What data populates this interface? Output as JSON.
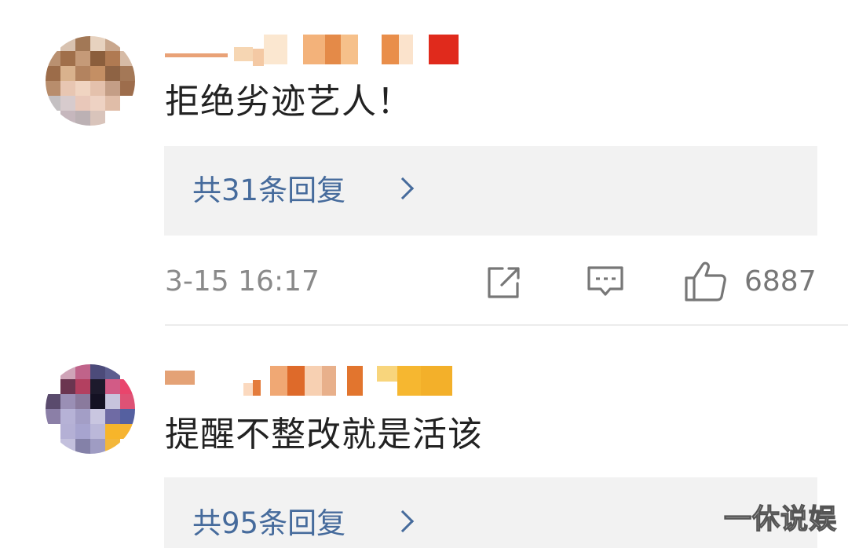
{
  "comments": [
    {
      "text": "拒绝劣迹艺人！",
      "replies_label": "共31条回复",
      "time": "3-15 16:17",
      "likes": "6887"
    },
    {
      "text": "提醒不整改就是活该",
      "replies_label": "共95条回复"
    }
  ],
  "watermark": "一休说娱",
  "colors": {
    "link": "#466b9c",
    "reply_panel_bg": "#f2f2f2",
    "meta_text": "#8a8a8a"
  },
  "icons": {
    "share": "share-external-icon",
    "comment": "comment-bubble-icon",
    "like": "thumbs-up-icon",
    "more": "chevron-right-icon"
  }
}
